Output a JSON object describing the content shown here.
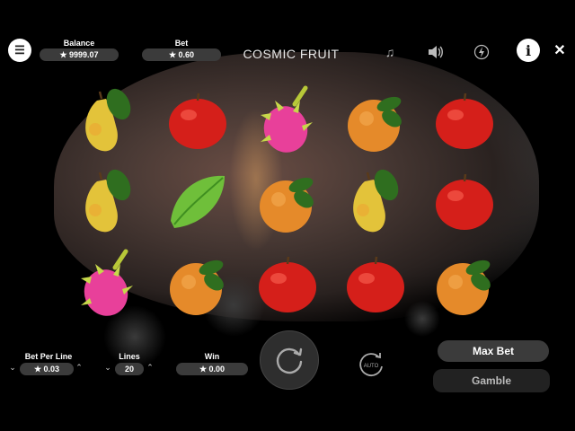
{
  "game": {
    "title": "COSMIC FRUIT"
  },
  "hud": {
    "balance_label": "Balance",
    "balance_value": "★ 9999.07",
    "bet_label": "Bet",
    "bet_value": "★ 0.60"
  },
  "controls": {
    "bet_per_line_label": "Bet Per Line",
    "bet_per_line_value": "★ 0.03",
    "lines_label": "Lines",
    "lines_value": "20",
    "win_label": "Win",
    "win_value": "★ 0.00",
    "auto_label": "AUTO",
    "max_bet_label": "Max Bet",
    "gamble_label": "Gamble"
  },
  "icons": {
    "menu": "hamburger-menu-icon",
    "music": "music-note-icon",
    "sound": "speaker-icon",
    "turbo": "lightning-icon",
    "info": "info-icon",
    "close": "close-icon",
    "spin": "spin-arrow-icon",
    "autoplay": "autoplay-icon"
  },
  "reels": [
    [
      "pear",
      "pear",
      "dragonfruit"
    ],
    [
      "apple",
      "starfruit",
      "orange"
    ],
    [
      "dragonfruit",
      "orange",
      "apple"
    ],
    [
      "orange",
      "pear",
      "apple"
    ],
    [
      "apple",
      "apple",
      "orange"
    ]
  ],
  "colors": {
    "apple": "#d51f1a",
    "orange": "#e58a2a",
    "pear": "#e3c33a",
    "starfruit": "#6fbf3a",
    "dragonfruit": "#e8409a",
    "leaf": "#2f6e1f"
  }
}
